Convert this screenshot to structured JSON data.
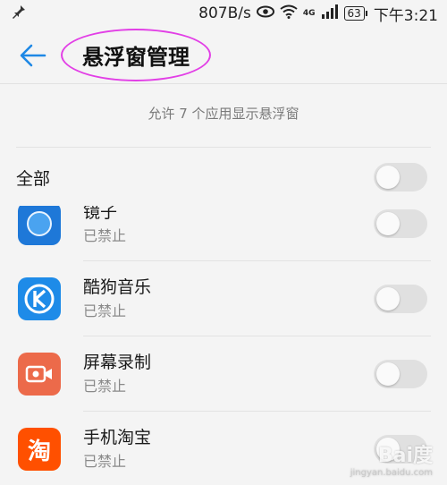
{
  "status_bar": {
    "speed": "807B/s",
    "network": "4G",
    "battery": "63",
    "time": "下午3:21"
  },
  "header": {
    "title": "悬浮窗管理"
  },
  "summary": "允许 7 个应用显示悬浮窗",
  "all_toggle": {
    "label": "全部",
    "enabled": false
  },
  "apps": [
    {
      "name": "镜子",
      "status": "已禁止",
      "icon_color": "#1e78d8",
      "enabled": false
    },
    {
      "name": "酷狗音乐",
      "status": "已禁止",
      "icon_color": "#1e8be8",
      "icon_glyph": "K",
      "enabled": false
    },
    {
      "name": "屏幕录制",
      "status": "已禁止",
      "icon_color": "#ec6a4a",
      "enabled": false
    },
    {
      "name": "手机淘宝",
      "status": "已禁止",
      "icon_color": "#ff5000",
      "icon_glyph": "淘",
      "enabled": false
    }
  ],
  "watermark": {
    "brand": "Bai度",
    "site": "jingyan.baidu.com"
  },
  "colors": {
    "accent": "#1e88e5",
    "highlight_ring": "#e23fe6"
  }
}
